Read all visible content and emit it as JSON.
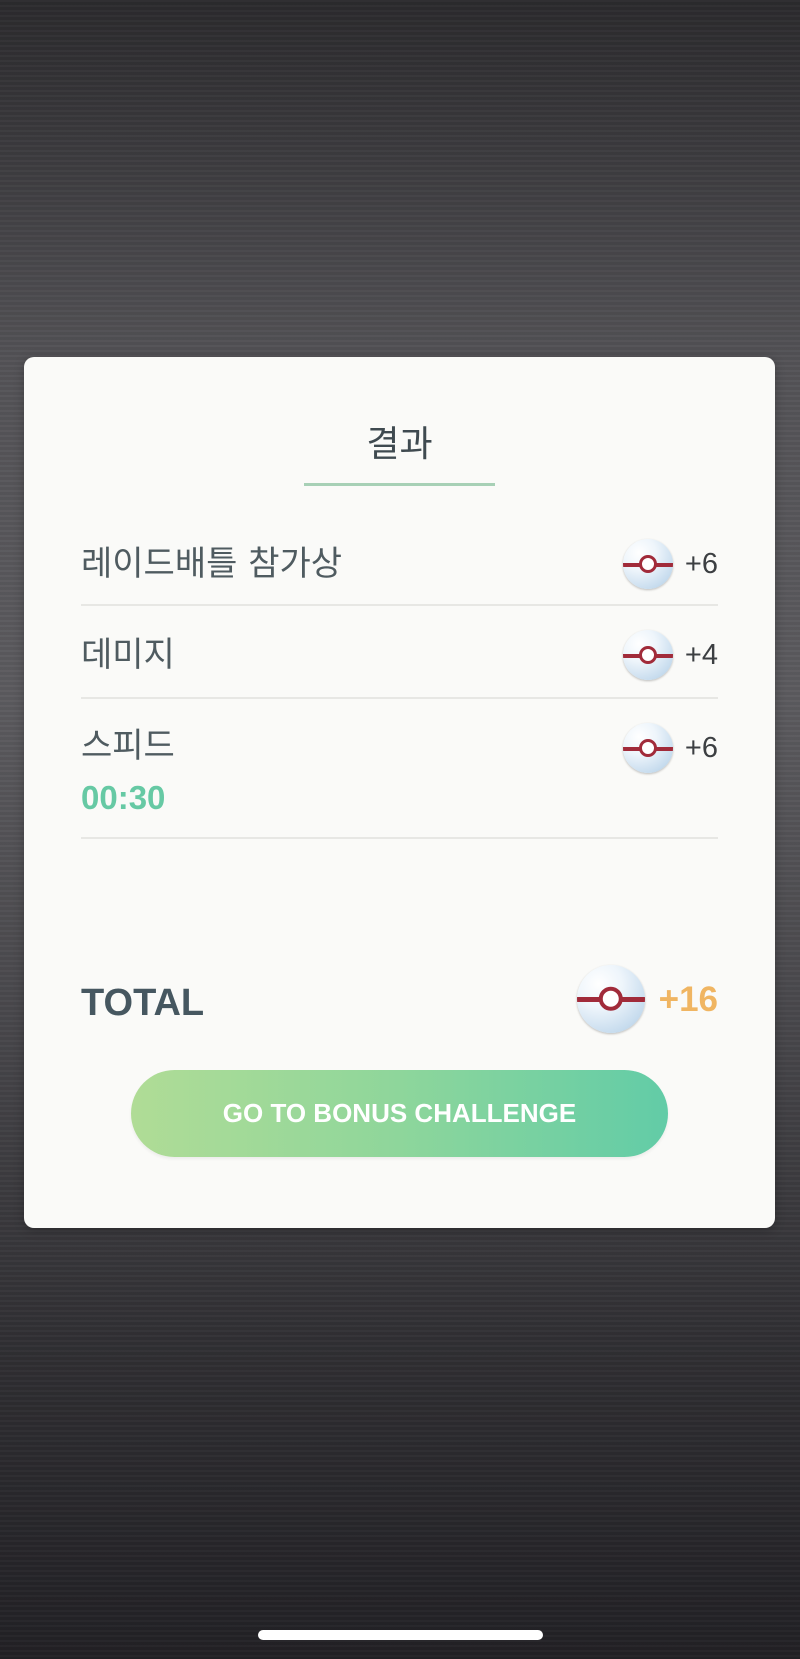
{
  "result_card": {
    "title": "결과",
    "rows": [
      {
        "label": "레이드배틀 참가상",
        "reward_icon": "premier-ball-icon",
        "reward": "+6"
      },
      {
        "label": "데미지",
        "reward_icon": "premier-ball-icon",
        "reward": "+4"
      },
      {
        "label": "스피드",
        "sub_value": "00:30",
        "reward_icon": "premier-ball-icon",
        "reward": "+6"
      }
    ],
    "total": {
      "label": "TOTAL",
      "reward_icon": "premier-ball-icon",
      "value": "+16"
    },
    "bonus_button_label": "GO TO BONUS CHALLENGE"
  },
  "colors": {
    "accent_green": "#66c9a4",
    "total_value": "#f0b562",
    "button_gradient_start": "#b0dc96",
    "button_gradient_end": "#62cca7",
    "ball_band": "#a12b3a"
  }
}
